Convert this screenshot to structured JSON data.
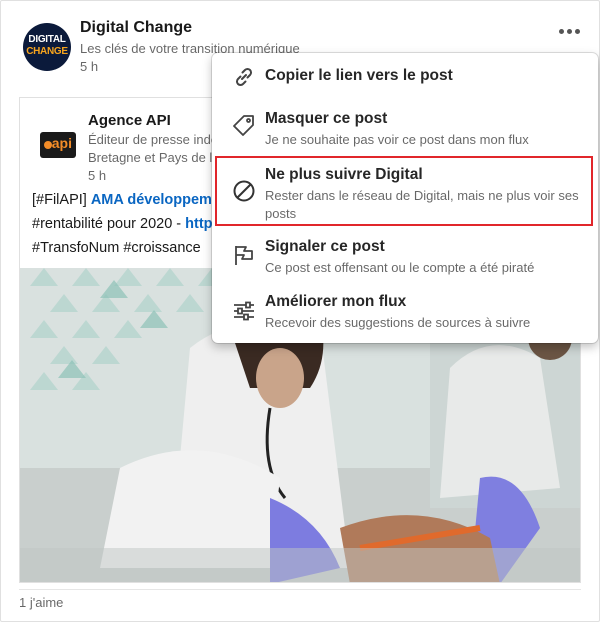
{
  "post": {
    "author": {
      "name": "Digital Change",
      "tagline": "Les clés de votre transition numérique",
      "time": "5 h",
      "logo_line1": "DIGITAL",
      "logo_line2": "CHANGE"
    },
    "shared": {
      "name": "Agence API",
      "subtitle_line1": "Éditeur de presse indépendant",
      "subtitle_line2": "Bretagne et Pays de la Loire",
      "time": "5 h",
      "logo_text": "api",
      "text_line1_prefix": "[#FilAPI] ",
      "text_line1_link": "AMA développement",
      "text_line2_prefix": "#rentabilité pour 2020 - ",
      "text_line2_link": "https://",
      "text_line3": "#TransfoNum #croissance"
    },
    "likes": "1 j'aime"
  },
  "menu": {
    "items": [
      {
        "title": "Copier le lien vers le post",
        "description": "",
        "icon": "link-icon"
      },
      {
        "title": "Masquer ce post",
        "description": "Je ne souhaite pas voir ce post dans mon flux",
        "icon": "tag-icon"
      },
      {
        "title": "Ne plus suivre Digital",
        "description": "Rester dans le réseau de Digital, mais ne plus voir ses posts",
        "icon": "unfollow-icon",
        "highlighted": true
      },
      {
        "title": "Signaler ce post",
        "description": "Ce post est offensant ou le compte a été piraté",
        "icon": "flag-icon"
      },
      {
        "title": "Améliorer mon flux",
        "description": "Recevoir des suggestions de sources à suivre",
        "icon": "sliders-icon"
      }
    ]
  },
  "colors": {
    "link": "#0a66c2",
    "highlight_border": "#e1262b",
    "logo_accent": "#f7a41d"
  }
}
